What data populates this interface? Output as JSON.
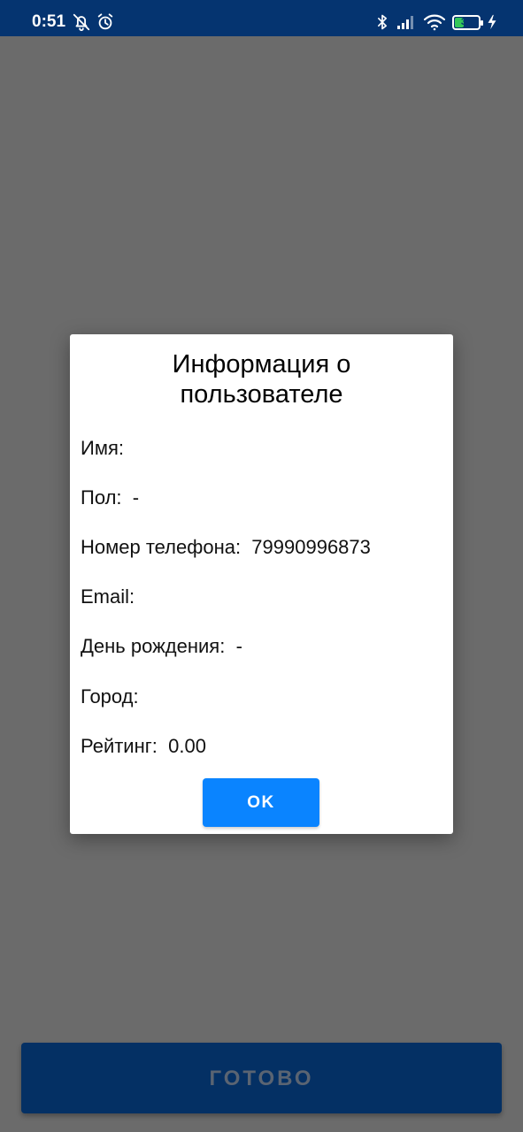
{
  "status_bar": {
    "time": "0:51",
    "battery_level": "39",
    "battery_fraction": 0.39,
    "left_icons": [
      "notifications-off-icon",
      "alarm-clock-icon"
    ],
    "right_icons": [
      "bluetooth-icon",
      "cell-signal-icon",
      "wifi-icon",
      "battery-icon",
      "charging-bolt-icon"
    ],
    "background_color": "#053470"
  },
  "dialog": {
    "title": "Информация о пользователе",
    "fields": [
      {
        "label": "Имя:",
        "value": ""
      },
      {
        "label": "Пол:",
        "value": "-"
      },
      {
        "label": "Номер телефона:",
        "value": "79990996873"
      },
      {
        "label": "Email:",
        "value": ""
      },
      {
        "label": "День рождения:",
        "value": "-"
      },
      {
        "label": "Город:",
        "value": ""
      },
      {
        "label": "Рейтинг:",
        "value": "0.00"
      }
    ],
    "ok_label": "OK",
    "ok_color": "#0a84ff"
  },
  "footer": {
    "done_label": "ГОТОВО",
    "done_color": "#043064"
  },
  "overlay_color": "#6b6b6b"
}
